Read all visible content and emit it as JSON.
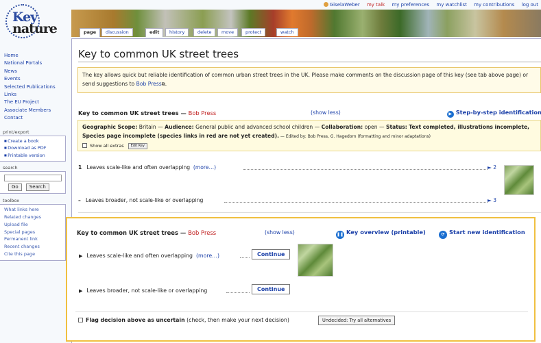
{
  "personal": {
    "user": "GiselaWeber",
    "talk": "my talk",
    "preferences": "my preferences",
    "watchlist": "my watchlist",
    "contributions": "my contributions",
    "logout": "log out"
  },
  "logo": {
    "line1": "Key",
    "line2": "nature"
  },
  "tabs": [
    "page",
    "discussion",
    "edit",
    "history",
    "delete",
    "move",
    "protect",
    "watch"
  ],
  "sidebar": {
    "nav": [
      "Home",
      "National Portals",
      "News",
      "Events",
      "Selected Publications",
      "Links",
      "The EU Project",
      "Associate Members",
      "Contact"
    ],
    "printexport_title": "print/export",
    "printexport": [
      "Create a book",
      "Download as PDF",
      "Printable version"
    ],
    "search_title": "search",
    "go": "Go",
    "search": "Search",
    "toolbox_title": "toolbox",
    "toolbox": [
      "What links here",
      "Related changes",
      "Upload file",
      "Special pages",
      "Permanent link",
      "Recent changes",
      "Cite this page"
    ]
  },
  "page": {
    "title": "Key to common UK street trees",
    "notice_text": "The key allows quick but reliable identification of common urban street trees in the UK. Please make comments on the discussion page of this key (see tab above page) or send suggestions to ",
    "notice_link": "Bob Press",
    "notice_end": ".",
    "key_title": "Key to common UK street trees",
    "key_dash": " — ",
    "key_author": "Bob Press",
    "show_less": "(show less)",
    "step_by_step": "Step-by-step identification",
    "meta": {
      "geo_label": "Geographic Scope:",
      "geo": "Britain",
      "aud_label": "Audience:",
      "aud": "General public and advanced school children",
      "collab_label": "Collaboration:",
      "collab": "open",
      "status_label": "Status:",
      "status": "Text completed, illustrations incomplete, Species page incomplete (species links in red are not yet created).",
      "edited": " — Edited by: Bob Press, G. Hagedorn (formatting and minor adaptations)",
      "show_extras": "Show all extras",
      "edit_key": "Edit Key"
    },
    "leads": [
      {
        "num": "1",
        "text": "Leaves scale-like and often overlapping",
        "more": "(more…)",
        "goto": "► 2"
      },
      {
        "num": "–",
        "text": "Leaves broader, not scale-like or overlapping",
        "goto": "► 3"
      }
    ]
  },
  "panel": {
    "title": "Key to common UK street trees",
    "dash": " — ",
    "author": "Bob Press",
    "show_less": "(show less)",
    "overview": "Key overview (printable)",
    "new_id": "Start new identification",
    "options": [
      {
        "text": "Leaves scale-like and often overlapping",
        "more": "(more…)",
        "button": "Continue"
      },
      {
        "text": "Leaves broader, not scale-like or overlapping",
        "button": "Continue"
      }
    ],
    "flag_label": "Flag decision above as uncertain",
    "flag_hint": "(check, then make your next decision)",
    "undecided": "Undecided: Try all alternatives"
  },
  "colors": {
    "accent": "#1a3fa8",
    "redlink": "#c02020",
    "highlight_border": "#f0c040",
    "notice_bg": "#fffbe8"
  }
}
